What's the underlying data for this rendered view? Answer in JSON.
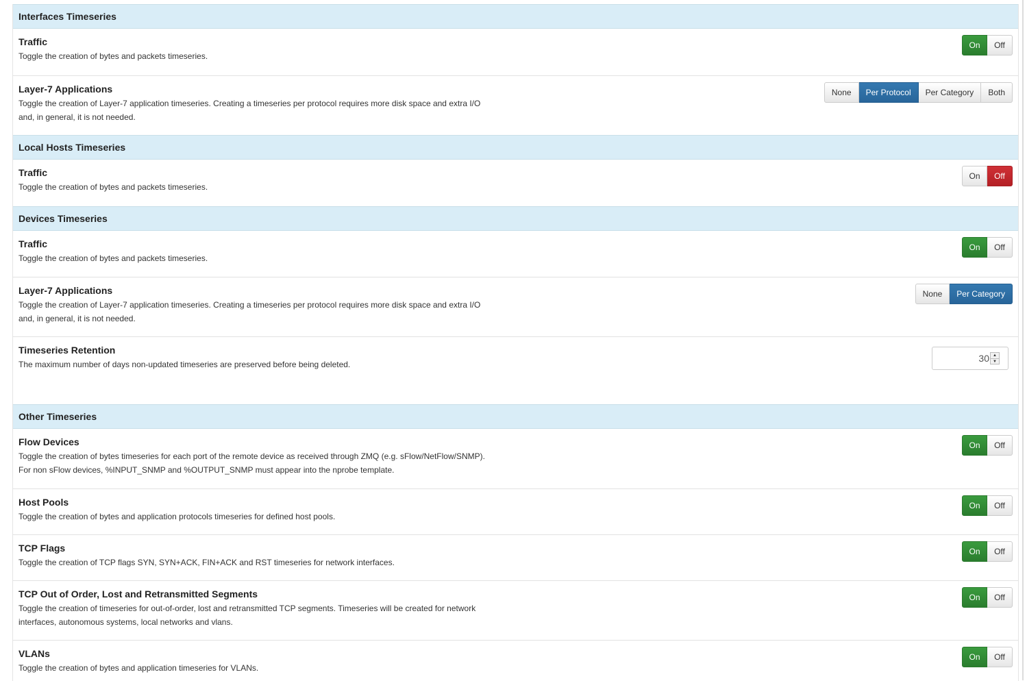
{
  "sections": {
    "interfaces": {
      "title": "Interfaces Timeseries",
      "traffic": {
        "title": "Traffic",
        "desc": "Toggle the creation of bytes and packets timeseries.",
        "on": "On",
        "off": "Off",
        "state": "on"
      },
      "l7": {
        "title": "Layer-7 Applications",
        "desc1": "Toggle the creation of Layer-7 application timeseries. Creating a timeseries per protocol requires more disk space and extra I/O",
        "desc2": "and, in general, it is not needed.",
        "options": [
          "None",
          "Per Protocol",
          "Per Category",
          "Both"
        ],
        "selected": "Per Protocol"
      }
    },
    "local_hosts": {
      "title": "Local Hosts Timeseries",
      "traffic": {
        "title": "Traffic",
        "desc": "Toggle the creation of bytes and packets timeseries.",
        "on": "On",
        "off": "Off",
        "state": "off"
      }
    },
    "devices": {
      "title": "Devices Timeseries",
      "traffic": {
        "title": "Traffic",
        "desc": "Toggle the creation of bytes and packets timeseries.",
        "on": "On",
        "off": "Off",
        "state": "on"
      },
      "l7": {
        "title": "Layer-7 Applications",
        "desc1": "Toggle the creation of Layer-7 application timeseries. Creating a timeseries per protocol requires more disk space and extra I/O",
        "desc2": "and, in general, it is not needed.",
        "options": [
          "None",
          "Per Category"
        ],
        "selected": "Per Category"
      },
      "retention": {
        "title": "Timeseries Retention",
        "desc": "The maximum number of days non-updated timeseries are preserved before being deleted.",
        "value": "30"
      }
    },
    "other": {
      "title": "Other Timeseries",
      "flow_devices": {
        "title": "Flow Devices",
        "desc1": "Toggle the creation of bytes timeseries for each port of the remote device as received through ZMQ (e.g. sFlow/NetFlow/SNMP).",
        "desc2": "For non sFlow devices, %INPUT_SNMP and %OUTPUT_SNMP must appear into the nprobe template.",
        "on": "On",
        "off": "Off",
        "state": "on"
      },
      "host_pools": {
        "title": "Host Pools",
        "desc": "Toggle the creation of bytes and application protocols timeseries for defined host pools.",
        "on": "On",
        "off": "Off",
        "state": "on"
      },
      "tcp_flags": {
        "title": "TCP Flags",
        "desc": "Toggle the creation of TCP flags SYN, SYN+ACK, FIN+ACK and RST timeseries for network interfaces.",
        "on": "On",
        "off": "Off",
        "state": "on"
      },
      "tcp_ooo": {
        "title": "TCP Out of Order, Lost and Retransmitted Segments",
        "desc1": "Toggle the creation of timeseries for out-of-order, lost and retransmitted TCP segments. Timeseries will be created for network",
        "desc2": "interfaces, autonomous systems, local networks and vlans.",
        "on": "On",
        "off": "Off",
        "state": "on"
      },
      "vlans": {
        "title": "VLANs",
        "desc": "Toggle the creation of bytes and application timeseries for VLANs.",
        "on": "On",
        "off": "Off",
        "state": "on"
      }
    }
  },
  "colors": {
    "header_bg": "#d9edf7",
    "on": "#2f8b33",
    "off": "#c1272d",
    "selected": "#2d6ca2"
  }
}
